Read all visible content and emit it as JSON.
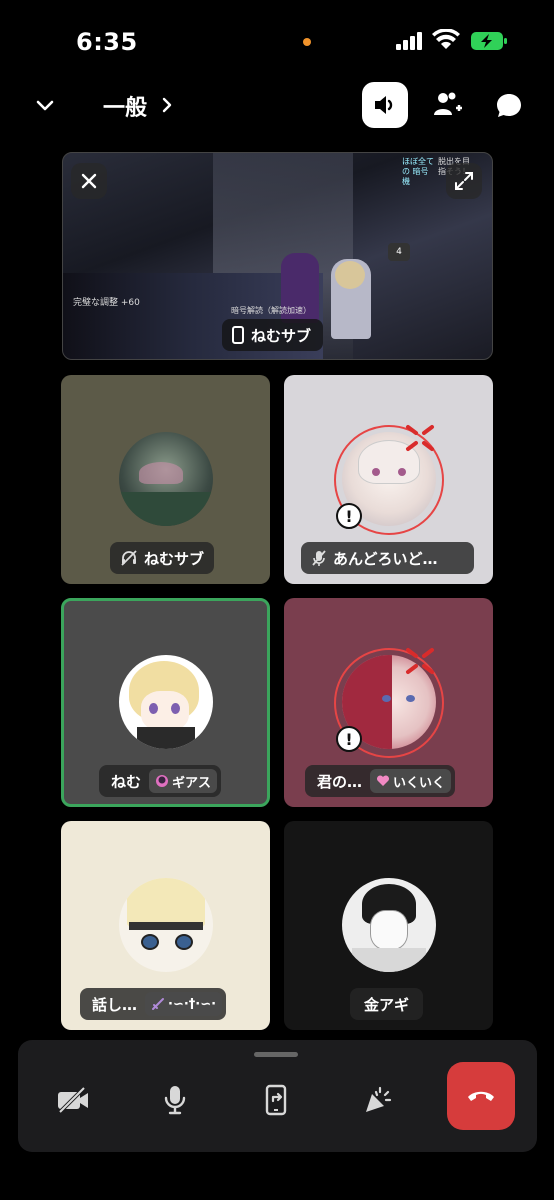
{
  "status_bar": {
    "time": "6:35",
    "colors": {
      "privacy_dot": "#f0932b",
      "battery": "#30d158"
    }
  },
  "header": {
    "channel_name": "一般",
    "icons": [
      "chevron-down-icon",
      "chevron-right-icon",
      "speaker-icon",
      "add-person-icon",
      "chat-bubble-icon"
    ]
  },
  "stream": {
    "streamer_label": "ねむサブ",
    "hud_left": "完璧な調整 +60",
    "hud_bottom": "暗号解読（解読加速）",
    "hud_top_a": "ほぼ全ての 暗号機",
    "hud_top_b": "脱出を目 指そう！",
    "hud_badge": "4"
  },
  "tiles": [
    {
      "name": "ねむサブ",
      "muted_status": "deafened",
      "bg": "#5c5a48"
    },
    {
      "name": "あんどろいど…",
      "muted_status": "muted",
      "bg": "#d8d6da"
    },
    {
      "name": "ねむ",
      "tag": "ギアス",
      "speaking": true,
      "bg": "#4b4b4b",
      "accent": "#3ba55c"
    },
    {
      "name": "君の…",
      "tag": "いくいく",
      "bg": "#7a3e4e"
    },
    {
      "name": "話し…",
      "tag": "·∽·†·∽·",
      "bg": "#efe9d8"
    },
    {
      "name": "金アギ",
      "bg": "#151515"
    }
  ],
  "controls": {
    "icons": [
      "camera-off-icon",
      "microphone-icon",
      "screen-share-icon",
      "soundboard-icon",
      "end-call-icon"
    ],
    "end_call_color": "#d63c3c"
  }
}
